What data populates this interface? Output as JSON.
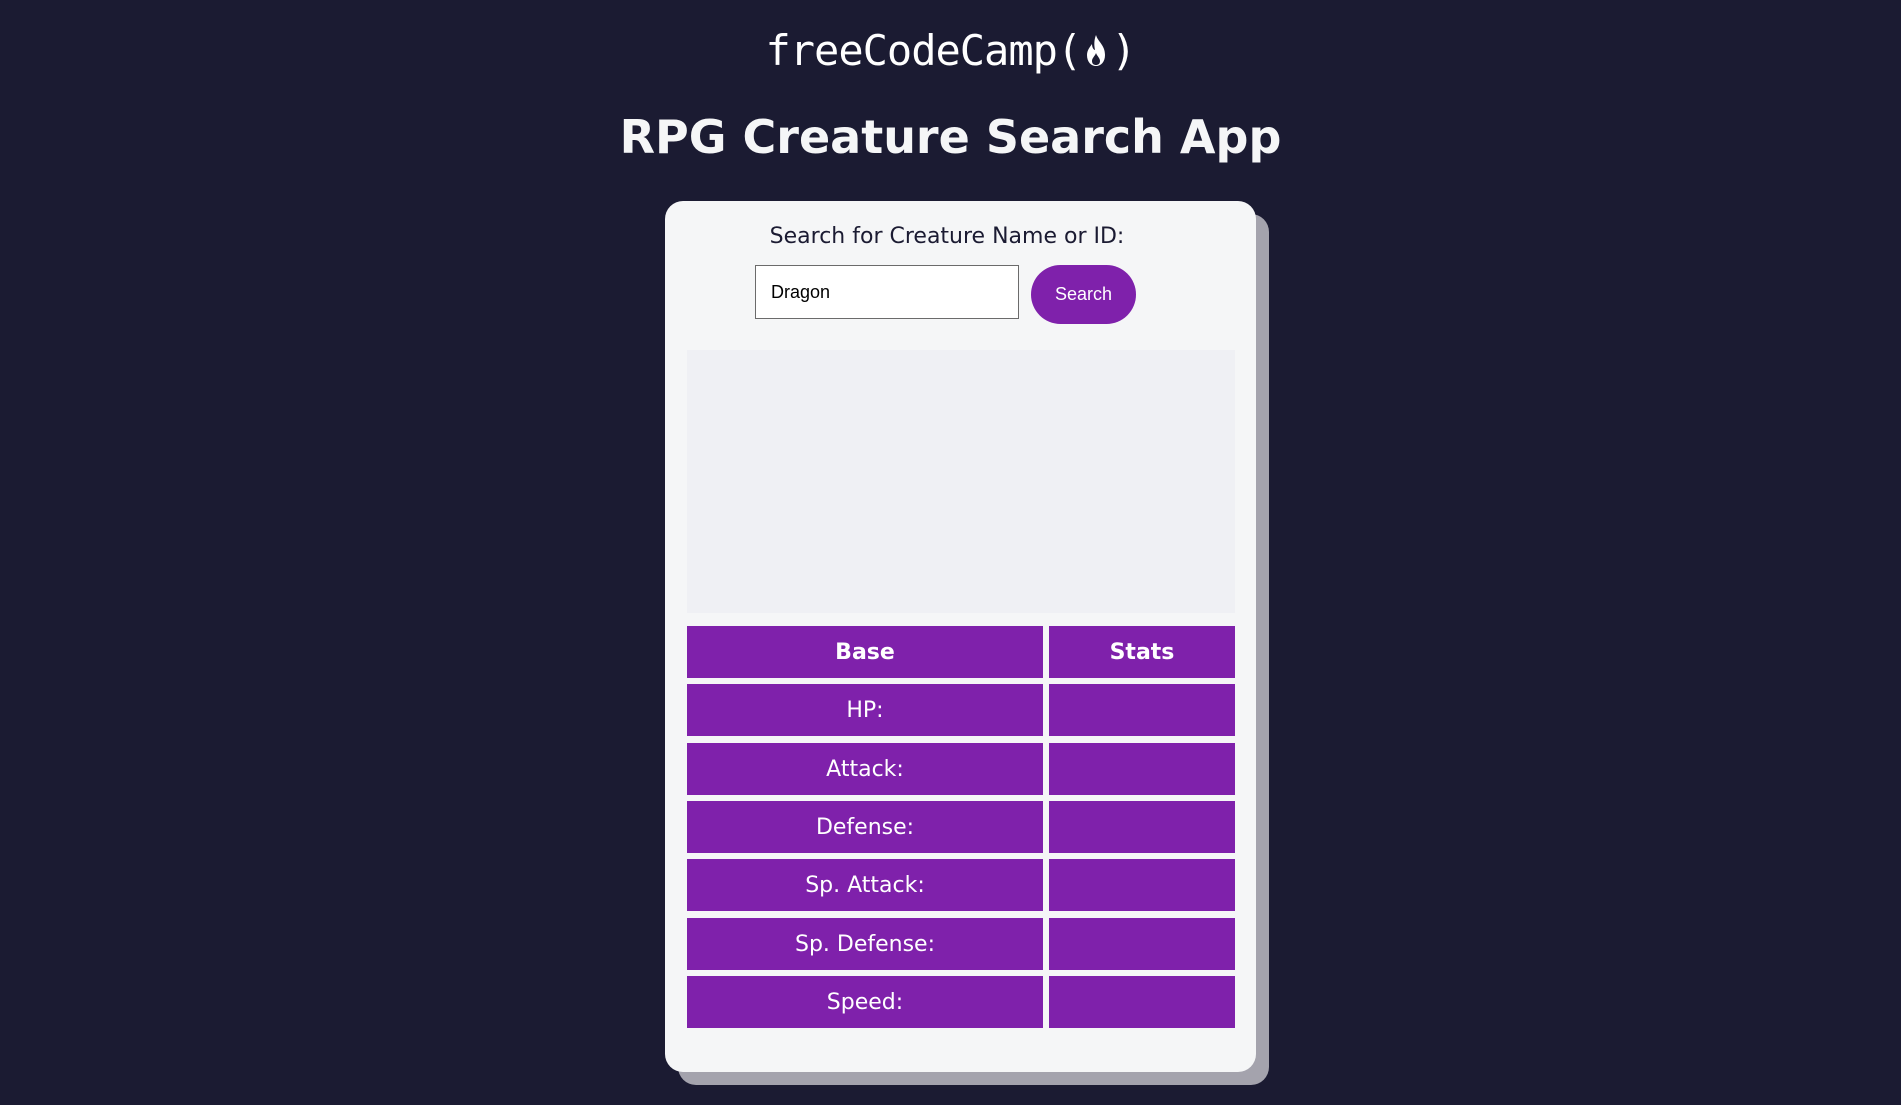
{
  "header": {
    "logo_text": "freeCodeCamp(",
    "logo_close": ")",
    "logo_icon": "flame-icon",
    "title": "RPG Creature Search App"
  },
  "search": {
    "label": "Search for Creature Name or ID:",
    "value": "Dragon",
    "button_label": "Search"
  },
  "stats_table": {
    "headers": [
      "Base",
      "Stats"
    ],
    "rows": [
      {
        "label": "HP:",
        "value": ""
      },
      {
        "label": "Attack:",
        "value": ""
      },
      {
        "label": "Defense:",
        "value": ""
      },
      {
        "label": "Sp. Attack:",
        "value": ""
      },
      {
        "label": "Sp. Defense:",
        "value": ""
      },
      {
        "label": "Speed:",
        "value": ""
      }
    ]
  },
  "colors": {
    "background": "#1b1b32",
    "accent": "#7f21ab",
    "card": "#f5f6f7"
  }
}
